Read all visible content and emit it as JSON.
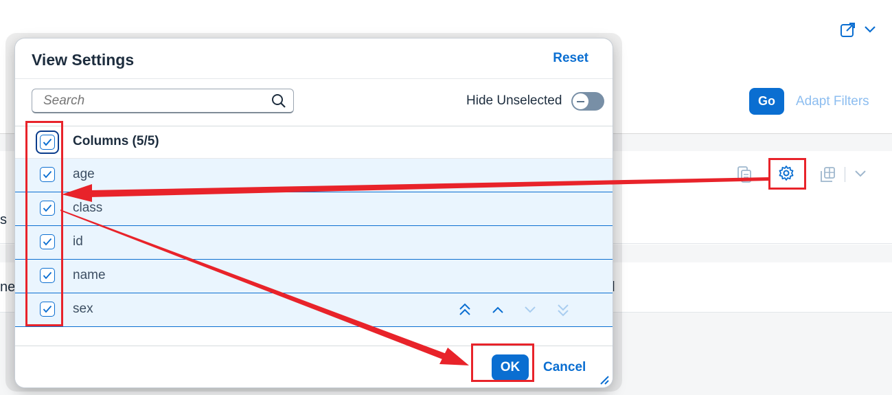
{
  "background": {
    "go_label": "Go",
    "adapt_filters_label": "Adapt Filters",
    "partial_left_1": "s",
    "partial_left_2": "ne",
    "partial_right": "ol"
  },
  "dialog": {
    "title": "View Settings",
    "reset_label": "Reset",
    "search": {
      "placeholder": "Search",
      "value": ""
    },
    "hide_unselected_label": "Hide Unselected",
    "hide_unselected_on": false,
    "columns_header": "Columns (5/5)",
    "rows": [
      {
        "label": "age",
        "checked": true
      },
      {
        "label": "class",
        "checked": true
      },
      {
        "label": "id",
        "checked": true
      },
      {
        "label": "name",
        "checked": true
      },
      {
        "label": "sex",
        "checked": true
      }
    ],
    "ok_label": "OK",
    "cancel_label": "Cancel"
  },
  "colors": {
    "accent": "#0a6ed1",
    "selection_bg": "#eaf5fe",
    "annotation_red": "#e8232a"
  },
  "icons": [
    "share-icon",
    "chevron-down-icon",
    "copy-icon",
    "gear-icon",
    "table-export-icon",
    "search-icon",
    "move-top-icon",
    "move-up-icon",
    "move-down-icon",
    "move-bottom-icon",
    "resize-handle-icon",
    "checkmark-icon"
  ]
}
